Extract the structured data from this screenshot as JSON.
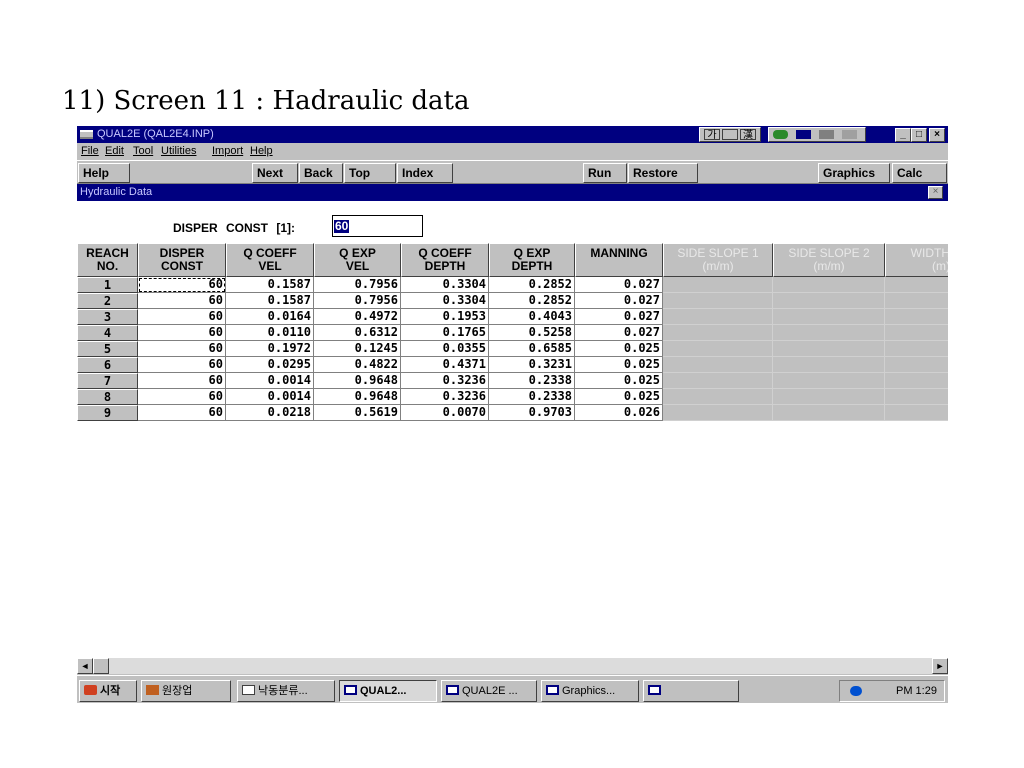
{
  "heading": "11) Screen 11 : Hadraulic data",
  "window": {
    "title": "QUAL2E (QAL2E4.INP)",
    "controls": [
      "_",
      "□",
      "×"
    ]
  },
  "ime": {
    "label1": "가",
    "label2": "🪰",
    "label3": "漢"
  },
  "menu": [
    {
      "label": "File"
    },
    {
      "label": "Edit"
    },
    {
      "label": "Tool"
    },
    {
      "label": "Utilities"
    },
    {
      "label": "Import"
    },
    {
      "label": "Help"
    }
  ],
  "toolbar": {
    "help": "Help",
    "next": "Next",
    "back": "Back",
    "top": "Top",
    "index": "Index",
    "run": "Run",
    "restore": "Restore",
    "graphics": "Graphics",
    "calc": "Calc"
  },
  "form": {
    "title": "Hydraulic Data",
    "close": "×",
    "disper_label": "DISPER CONST [1]:",
    "disper_value": "60"
  },
  "table": {
    "headers": [
      {
        "l1": "REACH",
        "l2": "NO."
      },
      {
        "l1": "DISPER",
        "l2": "CONST"
      },
      {
        "l1": "Q COEFF",
        "l2": "VEL"
      },
      {
        "l1": "Q EXP",
        "l2": "VEL"
      },
      {
        "l1": "Q COEFF",
        "l2": "DEPTH"
      },
      {
        "l1": "Q EXP",
        "l2": "DEPTH"
      },
      {
        "l1": "MANNING",
        "l2": ""
      },
      {
        "l1": "SIDE SLOPE 1",
        "l2": "(m/m)"
      },
      {
        "l1": "SIDE SLOPE 2",
        "l2": "(m/m)"
      },
      {
        "l1": "WIDTH",
        "l2": "(m)"
      }
    ],
    "rows": [
      [
        "1",
        "60",
        "0.1587",
        "0.7956",
        "0.3304",
        "0.2852",
        "0.027"
      ],
      [
        "2",
        "60",
        "0.1587",
        "0.7956",
        "0.3304",
        "0.2852",
        "0.027"
      ],
      [
        "3",
        "60",
        "0.0164",
        "0.4972",
        "0.1953",
        "0.4043",
        "0.027"
      ],
      [
        "4",
        "60",
        "0.0110",
        "0.6312",
        "0.1765",
        "0.5258",
        "0.027"
      ],
      [
        "5",
        "60",
        "0.1972",
        "0.1245",
        "0.0355",
        "0.6585",
        "0.025"
      ],
      [
        "6",
        "60",
        "0.0295",
        "0.4822",
        "0.4371",
        "0.3231",
        "0.025"
      ],
      [
        "7",
        "60",
        "0.0014",
        "0.9648",
        "0.3236",
        "0.2338",
        "0.025"
      ],
      [
        "8",
        "60",
        "0.0014",
        "0.9648",
        "0.3236",
        "0.2338",
        "0.025"
      ],
      [
        "9",
        "60",
        "0.0218",
        "0.5619",
        "0.0070",
        "0.9703",
        "0.026"
      ]
    ]
  },
  "scrollbar": {
    "left": "◄",
    "right": "►"
  },
  "taskbar": {
    "start": "시작",
    "tasks": [
      {
        "label": "원장업"
      },
      {
        "label": "낙동분류..."
      },
      {
        "label": "QUAL2..."
      },
      {
        "label": "QUAL2E ..."
      },
      {
        "label": "Graphics..."
      },
      {
        "label": ""
      }
    ],
    "clock": "PM 1:29"
  }
}
